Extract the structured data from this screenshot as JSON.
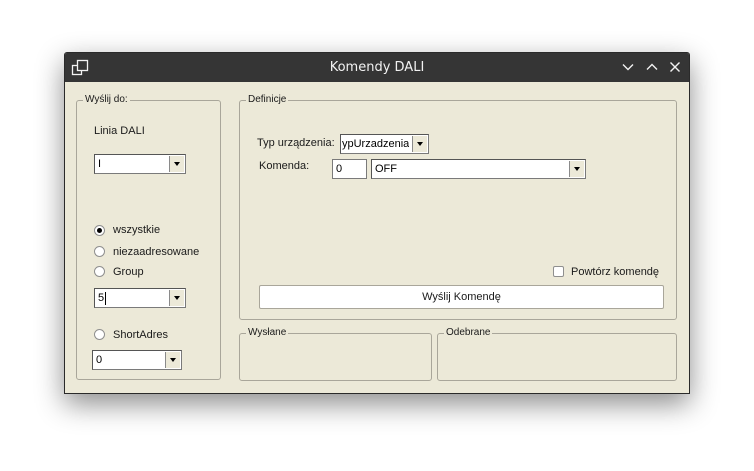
{
  "window": {
    "title": "Komendy DALI",
    "icons": {
      "app": "window-stack-icon",
      "minimize": "chevron-down-icon",
      "maximize": "chevron-up-icon",
      "close": "close-icon"
    }
  },
  "send_to": {
    "group_label": "Wyślij do:",
    "line_label": "Linia DALI",
    "line_value": "I",
    "radio_all": "wszystkie",
    "radio_unaddressed": "niezaadresowane",
    "radio_group": "Group",
    "group_value": "5",
    "radio_short": "ShortAdres",
    "short_value": "0"
  },
  "definitions": {
    "group_label": "Definicje",
    "device_type_label": "Typ urządzenia:",
    "device_type_value": "ypUrzadzenia",
    "command_label": "Komenda:",
    "command_number": "0",
    "command_value": "OFF",
    "repeat_label": "Powtórz komendę",
    "send_button": "Wyślij Komendę"
  },
  "sent": {
    "group_label": "Wysłane"
  },
  "received": {
    "group_label": "Odebrane"
  }
}
